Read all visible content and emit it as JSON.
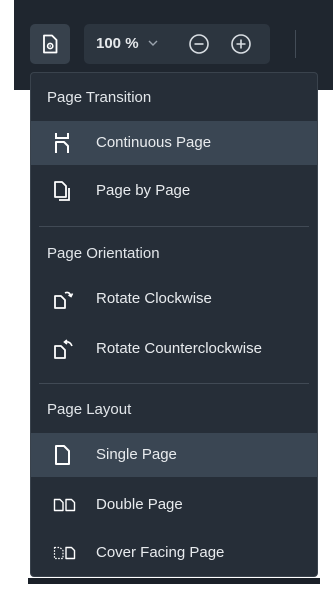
{
  "toolbar": {
    "zoom_value": "100 %",
    "icons": [
      "page-settings-icon",
      "chevron-down-icon",
      "zoom-out-icon",
      "zoom-in-icon"
    ]
  },
  "menu": {
    "sections": [
      {
        "header": "Page Transition",
        "items": [
          {
            "label": "Continuous Page",
            "icon": "continuous-page-icon",
            "selected": true
          },
          {
            "label": "Page by Page",
            "icon": "page-by-page-icon",
            "selected": false
          }
        ]
      },
      {
        "header": "Page Orientation",
        "items": [
          {
            "label": "Rotate Clockwise",
            "icon": "rotate-clockwise-icon",
            "selected": false
          },
          {
            "label": "Rotate Counterclockwise",
            "icon": "rotate-counterclockwise-icon",
            "selected": false
          }
        ]
      },
      {
        "header": "Page Layout",
        "items": [
          {
            "label": "Single Page",
            "icon": "single-page-icon",
            "selected": true
          },
          {
            "label": "Double Page",
            "icon": "double-page-icon",
            "selected": false
          },
          {
            "label": "Cover Facing Page",
            "icon": "cover-facing-page-icon",
            "selected": false
          }
        ]
      }
    ]
  },
  "colors": {
    "toolbar_bg": "#1f262f",
    "menu_bg": "#262e38",
    "selected_bg": "#3a4653",
    "text": "#e8ebee"
  }
}
